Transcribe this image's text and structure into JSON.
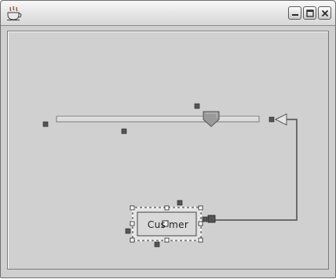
{
  "window": {
    "title": "",
    "icons": {
      "app": "java-cup-icon",
      "minimize": "minimize-icon",
      "maximize": "maximize-icon",
      "close": "close-icon"
    }
  },
  "diagram": {
    "node_label": "Cus mer",
    "elements": {
      "slider": "horizontal-slider-track",
      "thumb": "slider-thumb",
      "arrow": "arrowhead-left",
      "connector": "connector-line",
      "node": "customer-node"
    }
  },
  "colors": {
    "canvas": "#d0d0d0",
    "handle": "#555555",
    "connector": "#6b6b6b",
    "selection_dash": "#555555"
  }
}
